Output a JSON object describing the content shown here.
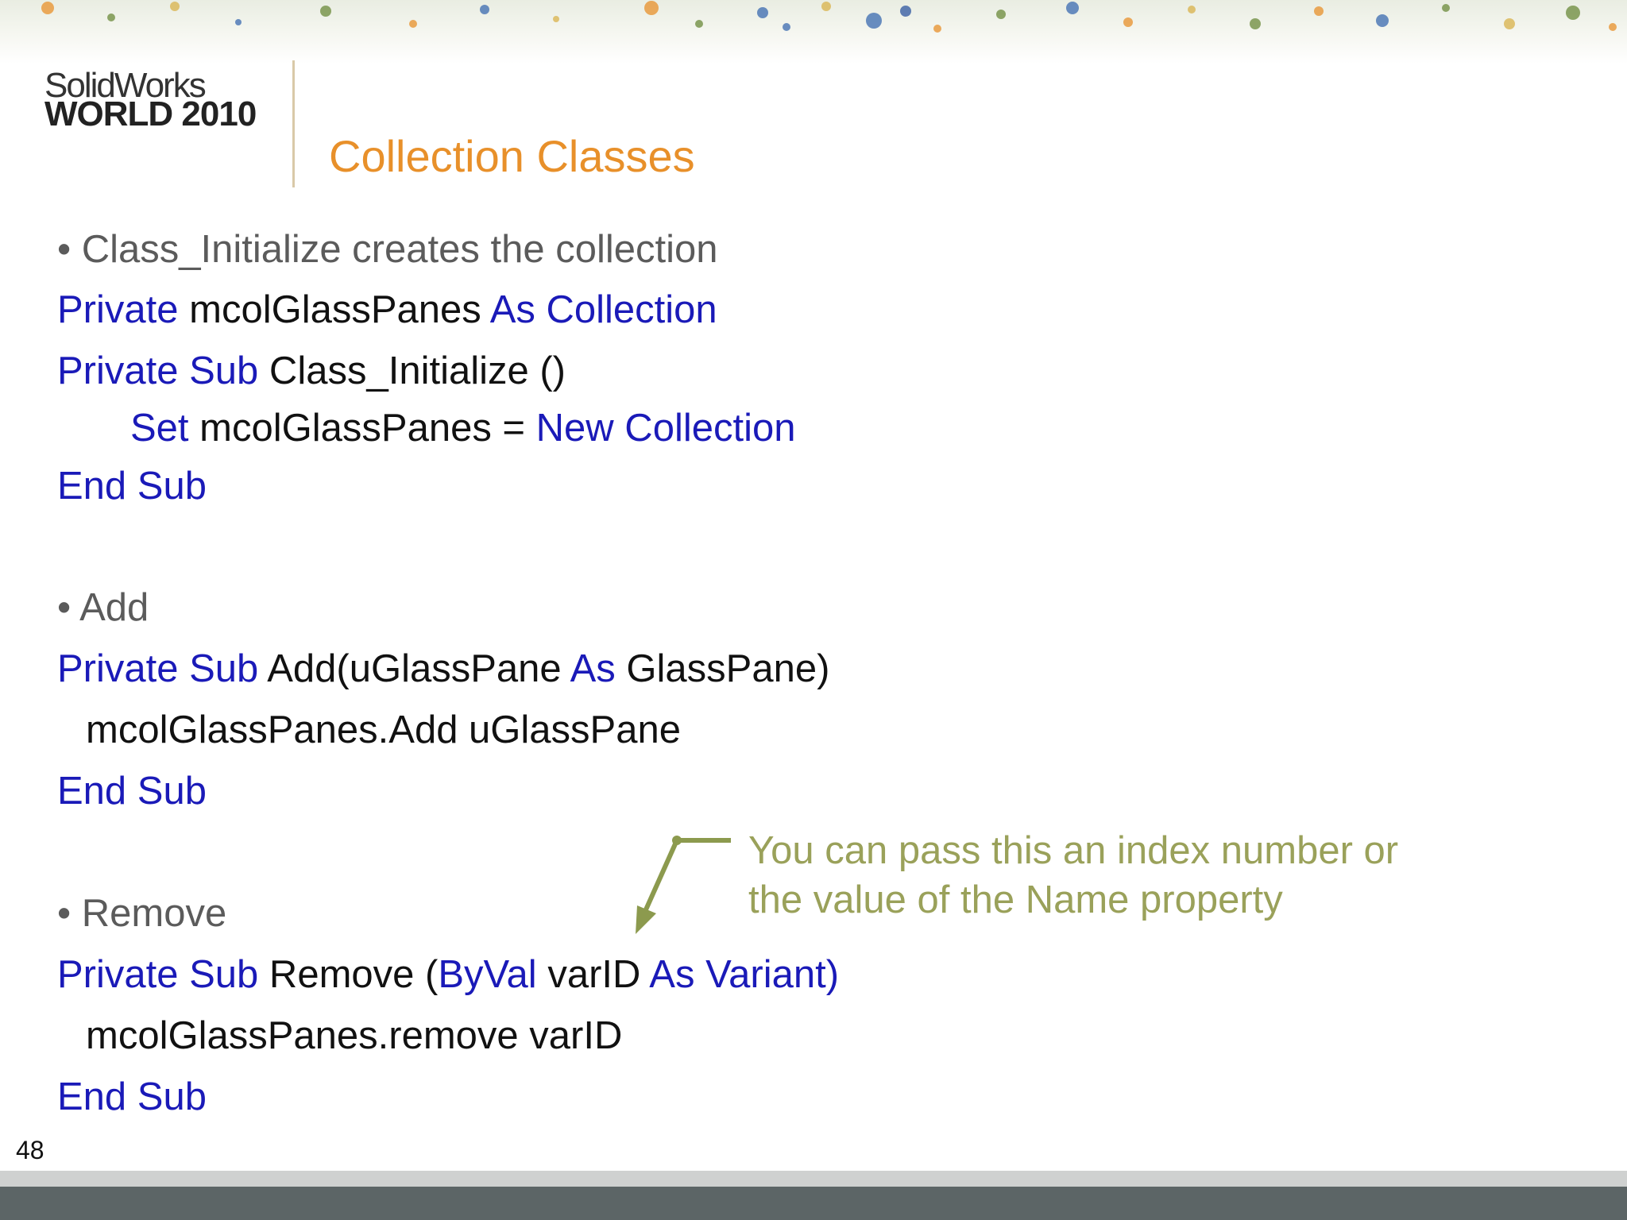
{
  "slide": {
    "logo_line1": "SolidWorks",
    "logo_line2": "WORLD 2010",
    "title": "Collection Classes",
    "page_number": "48"
  },
  "bullets": {
    "b1": "• Class_Initialize creates the collection",
    "b2": "• Add",
    "b3": "• Remove"
  },
  "code": {
    "l1": {
      "kw1": "Private",
      "tx1": " mcolGlassPanes ",
      "kw2": "As Collection"
    },
    "l2": {
      "kw1": "Private Sub",
      "tx1": " Class_Initialize ()"
    },
    "l3": {
      "kw1": "Set",
      "tx1": " mcolGlassPanes = ",
      "kw2": "New Collection"
    },
    "l4": {
      "kw1": "End Sub"
    },
    "l5": {
      "kw1": "Private Sub",
      "tx1": " Add(uGlassPane ",
      "kw2": "As",
      "tx2": " GlassPane)"
    },
    "l6": {
      "tx1": "mcolGlassPanes.Add uGlassPane"
    },
    "l7": {
      "kw1": "End Sub"
    },
    "l8": {
      "kw1": "Private Sub",
      "tx1": " Remove (",
      "kw2": "ByVal",
      "tx2": " varID ",
      "kw3": "As Variant)"
    },
    "l9": {
      "tx1": "mcolGlassPanes.remove varID"
    },
    "l10": {
      "kw1": "End Sub"
    }
  },
  "callout": {
    "line1": "You can pass this an index number or",
    "line2": "the value of the Name property"
  },
  "colors": {
    "title": "#e8902a",
    "keyword": "#1a1ab8",
    "callout": "#9aa15a",
    "bullet": "#5b5b5b"
  }
}
